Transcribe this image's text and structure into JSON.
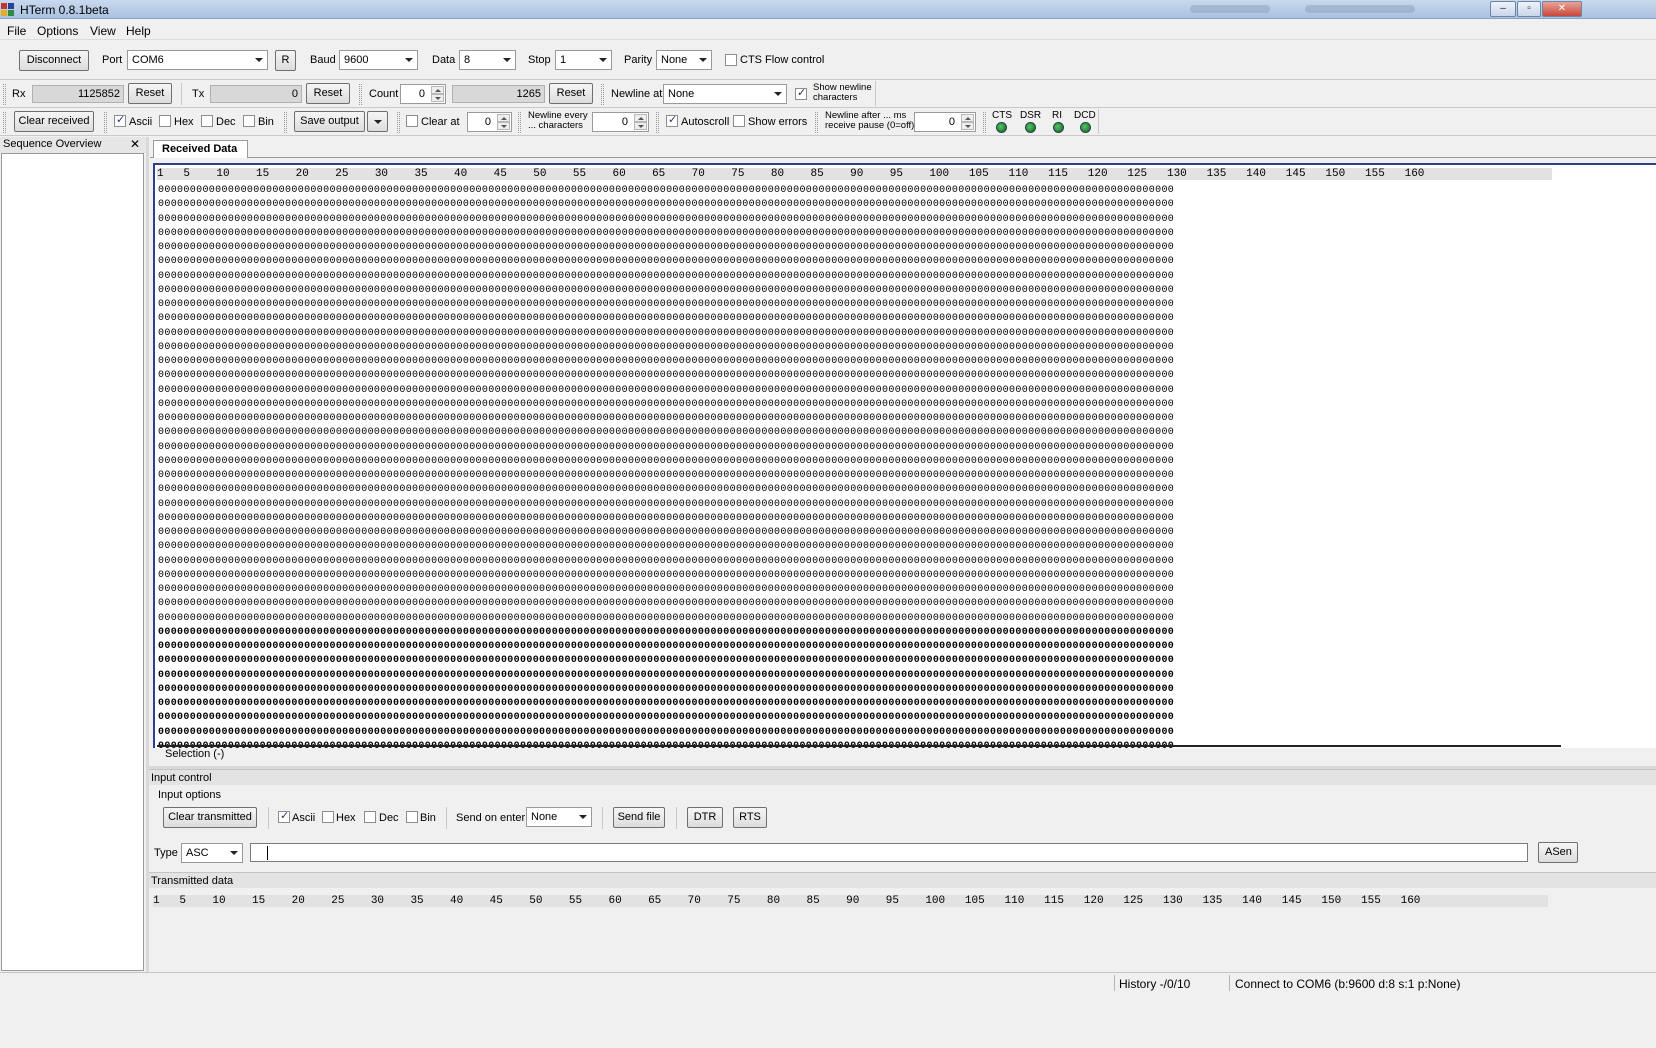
{
  "window": {
    "title": "HTerm 0.8.1beta"
  },
  "menu": [
    "File",
    "Options",
    "View",
    "Help"
  ],
  "connection": {
    "disconnect_label": "Disconnect",
    "port_label": "Port",
    "port_value": "COM6",
    "r_label": "R",
    "baud_label": "Baud",
    "baud_value": "9600",
    "data_label": "Data",
    "data_value": "8",
    "stop_label": "Stop",
    "stop_value": "1",
    "parity_label": "Parity",
    "parity_value": "None",
    "cts_label": "CTS Flow control"
  },
  "counters": {
    "rx_label": "Rx",
    "rx_value": "1125852",
    "rx_reset": "Reset",
    "tx_label": "Tx",
    "tx_value": "0",
    "tx_reset": "Reset",
    "count_label": "Count",
    "count_value": "0",
    "count_total": "1265",
    "count_reset": "Reset",
    "newline_at_label": "Newline at",
    "newline_at_value": "None",
    "show_newline_label": "Show newline characters"
  },
  "received_options": {
    "clear_received": "Clear received",
    "ascii": "Ascii",
    "hex": "Hex",
    "dec": "Dec",
    "bin": "Bin",
    "save_output": "Save output",
    "clear_at_label": "Clear at",
    "clear_at_value": "0",
    "newline_every_label": "Newline every ... characters",
    "newline_every_value": "0",
    "autoscroll": "Autoscroll",
    "show_errors": "Show errors",
    "newline_after_label": "Newline after ... ms receive pause (0=off)",
    "newline_after_value": "0",
    "leds": [
      "CTS",
      "DSR",
      "RI",
      "DCD"
    ]
  },
  "sequence": {
    "title": "Sequence Overview",
    "close": "✕"
  },
  "received": {
    "tab": "Received Data",
    "ruler": "1   5    10    15    20    25    30    35    40    45    50    55    60    65    70    75    80    85    90    95    100   105   110   115   120   125   130   135   140   145   150   155   160",
    "selection": "Selection (-)"
  },
  "input_control": {
    "title": "Input control",
    "options_title": "Input options",
    "clear_transmitted": "Clear transmitted",
    "ascii": "Ascii",
    "hex": "Hex",
    "dec": "Dec",
    "bin": "Bin",
    "send_on_enter_label": "Send on enter",
    "send_on_enter_value": "None",
    "send_file": "Send file",
    "dtr": "DTR",
    "rts": "RTS",
    "type_label": "Type",
    "type_value": "ASC",
    "asend": "ASen"
  },
  "transmitted": {
    "title": "Transmitted data",
    "ruler": "1   5    10    15    20    25    30    35    40    45    50    55    60    65    70    75    80    85    90    95    100   105   110   115   120   125   130   135   140   145   150   155   160"
  },
  "status": {
    "history": "History -/0/10",
    "connection": "Connect to COM6 (b:9600 d:8 s:1 p:None)"
  }
}
